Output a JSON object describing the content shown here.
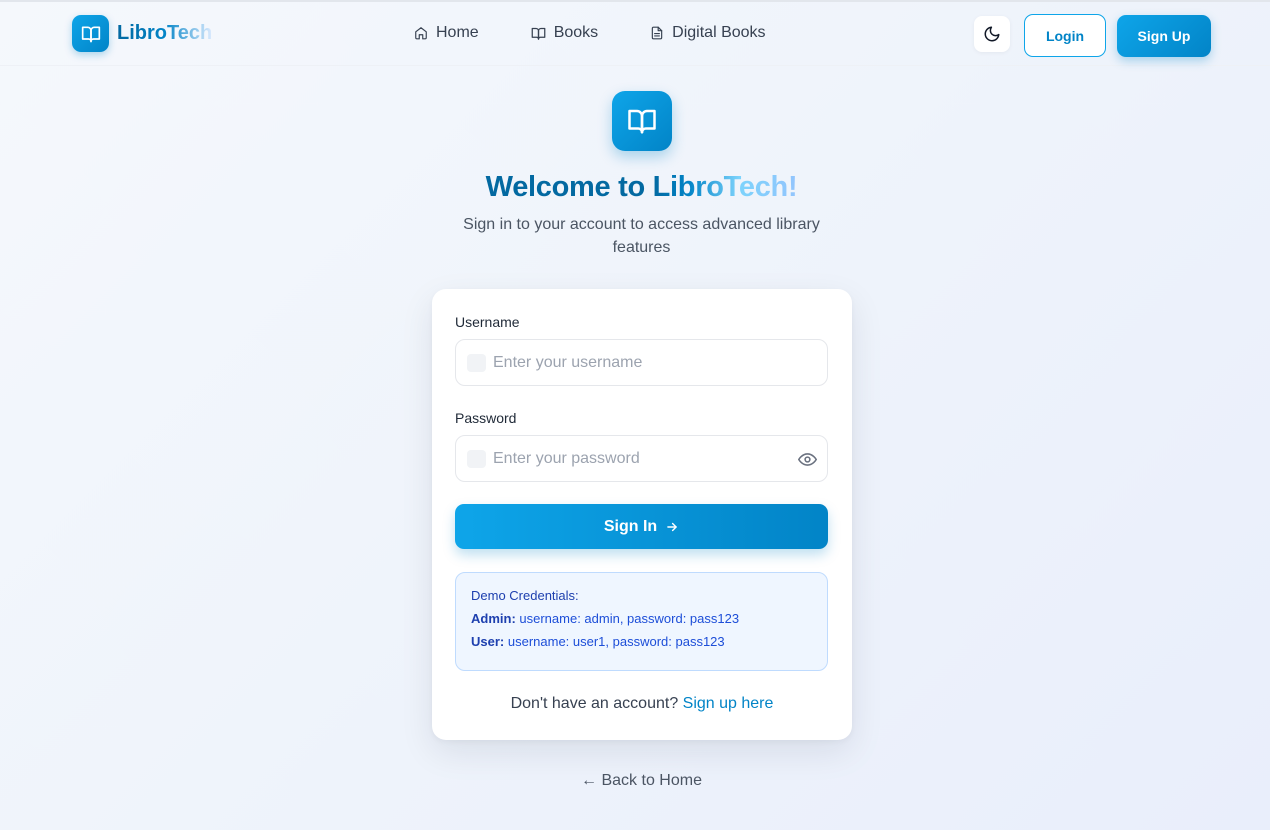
{
  "brand": {
    "name": "LibroTech",
    "logo_icon": "open-book-icon"
  },
  "nav": {
    "links": [
      {
        "label": "Home",
        "icon": "home-icon"
      },
      {
        "label": "Books",
        "icon": "book-icon"
      },
      {
        "label": "Digital Books",
        "icon": "document-icon"
      }
    ],
    "theme_toggle_icon": "moon-icon",
    "login_label": "Login",
    "signup_label": "Sign Up"
  },
  "hero": {
    "title_prefix": "Welcome to ",
    "title_brand": "LibroTech!",
    "subtitle": "Sign in to your account to access advanced library features"
  },
  "form": {
    "username": {
      "label": "Username",
      "placeholder": "Enter your username",
      "value": ""
    },
    "password": {
      "label": "Password",
      "placeholder": "Enter your password",
      "value": ""
    },
    "submit_label": "Sign In"
  },
  "demo": {
    "title": "Demo Credentials:",
    "admin_label": "Admin:",
    "admin_text": " username: admin, password: pass123",
    "user_label": "User:",
    "user_text": " username: user1, password: pass123"
  },
  "footer": {
    "prompt": "Don't have an account?",
    "signup_link": "Sign up here",
    "back_link": "← Back to Home"
  },
  "colors": {
    "accent": "#0ea5e9",
    "accent_dark": "#0284c7",
    "title_blue": "#0369a1",
    "demo_bg": "#eff6ff",
    "demo_border": "#bfdbfe"
  }
}
